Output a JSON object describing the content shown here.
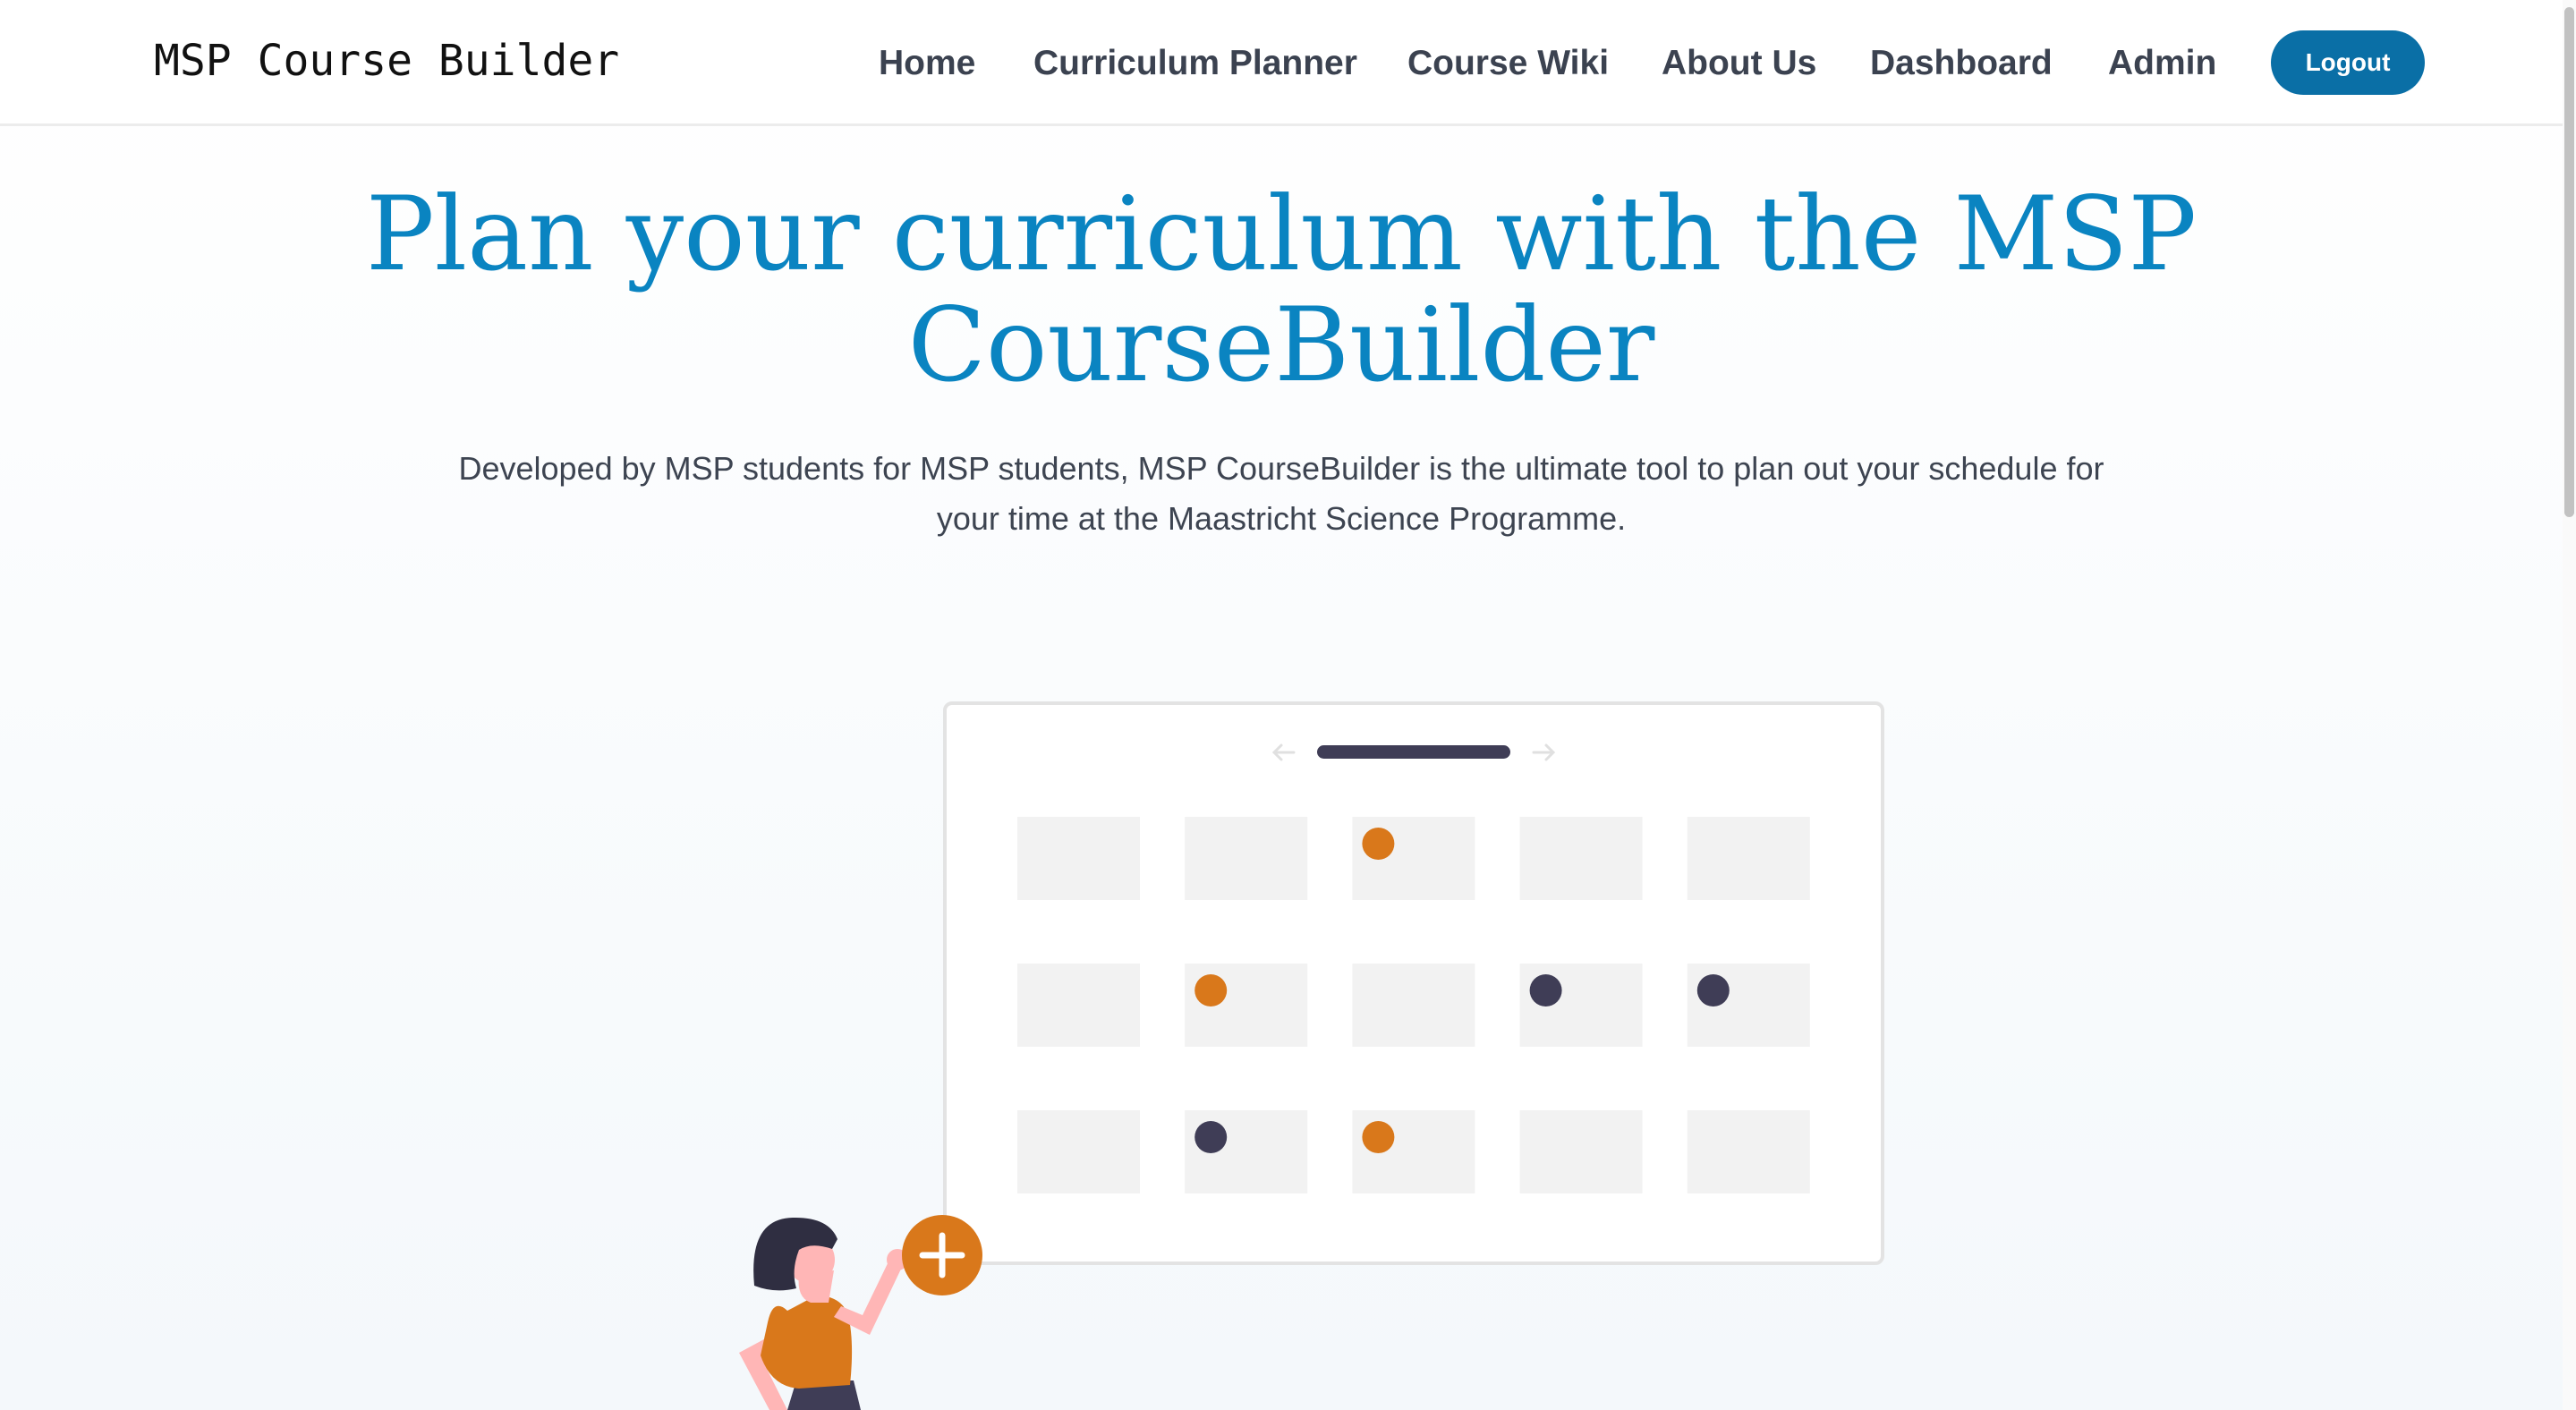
{
  "navbar": {
    "brand": "MSP Course Builder",
    "links": [
      {
        "label": "Home"
      },
      {
        "label": "Curriculum Planner"
      },
      {
        "label": "Course Wiki"
      },
      {
        "label": "About Us"
      },
      {
        "label": "Dashboard"
      },
      {
        "label": "Admin"
      }
    ],
    "logout_label": "Logout"
  },
  "hero": {
    "title_line1": "Plan your curriculum with the MSP",
    "title_line2": "CourseBuilder",
    "description_line1": "Developed by MSP students for MSP students, MSP CourseBuilder is the ultimate tool to plan out your schedule for",
    "description_line2": "your time at the Maastricht Science Programme."
  },
  "illustration": {
    "calendar_rows": 3,
    "calendar_cols": 5,
    "dots": [
      {
        "row": 0,
        "col": 2,
        "color": "orange"
      },
      {
        "row": 1,
        "col": 1,
        "color": "orange"
      },
      {
        "row": 1,
        "col": 3,
        "color": "dark"
      },
      {
        "row": 1,
        "col": 4,
        "color": "dark"
      },
      {
        "row": 2,
        "col": 1,
        "color": "dark"
      },
      {
        "row": 2,
        "col": 2,
        "color": "orange"
      }
    ],
    "colors": {
      "orange": "#d9781b",
      "dark": "#3f3d56",
      "cell": "#f2f2f2",
      "skin": "#ffb6b6"
    },
    "icons": [
      "arrow-left-icon",
      "arrow-right-icon",
      "plus-icon"
    ]
  },
  "colors": {
    "accent": "#0a84c1",
    "button": "#0a6fa6"
  }
}
